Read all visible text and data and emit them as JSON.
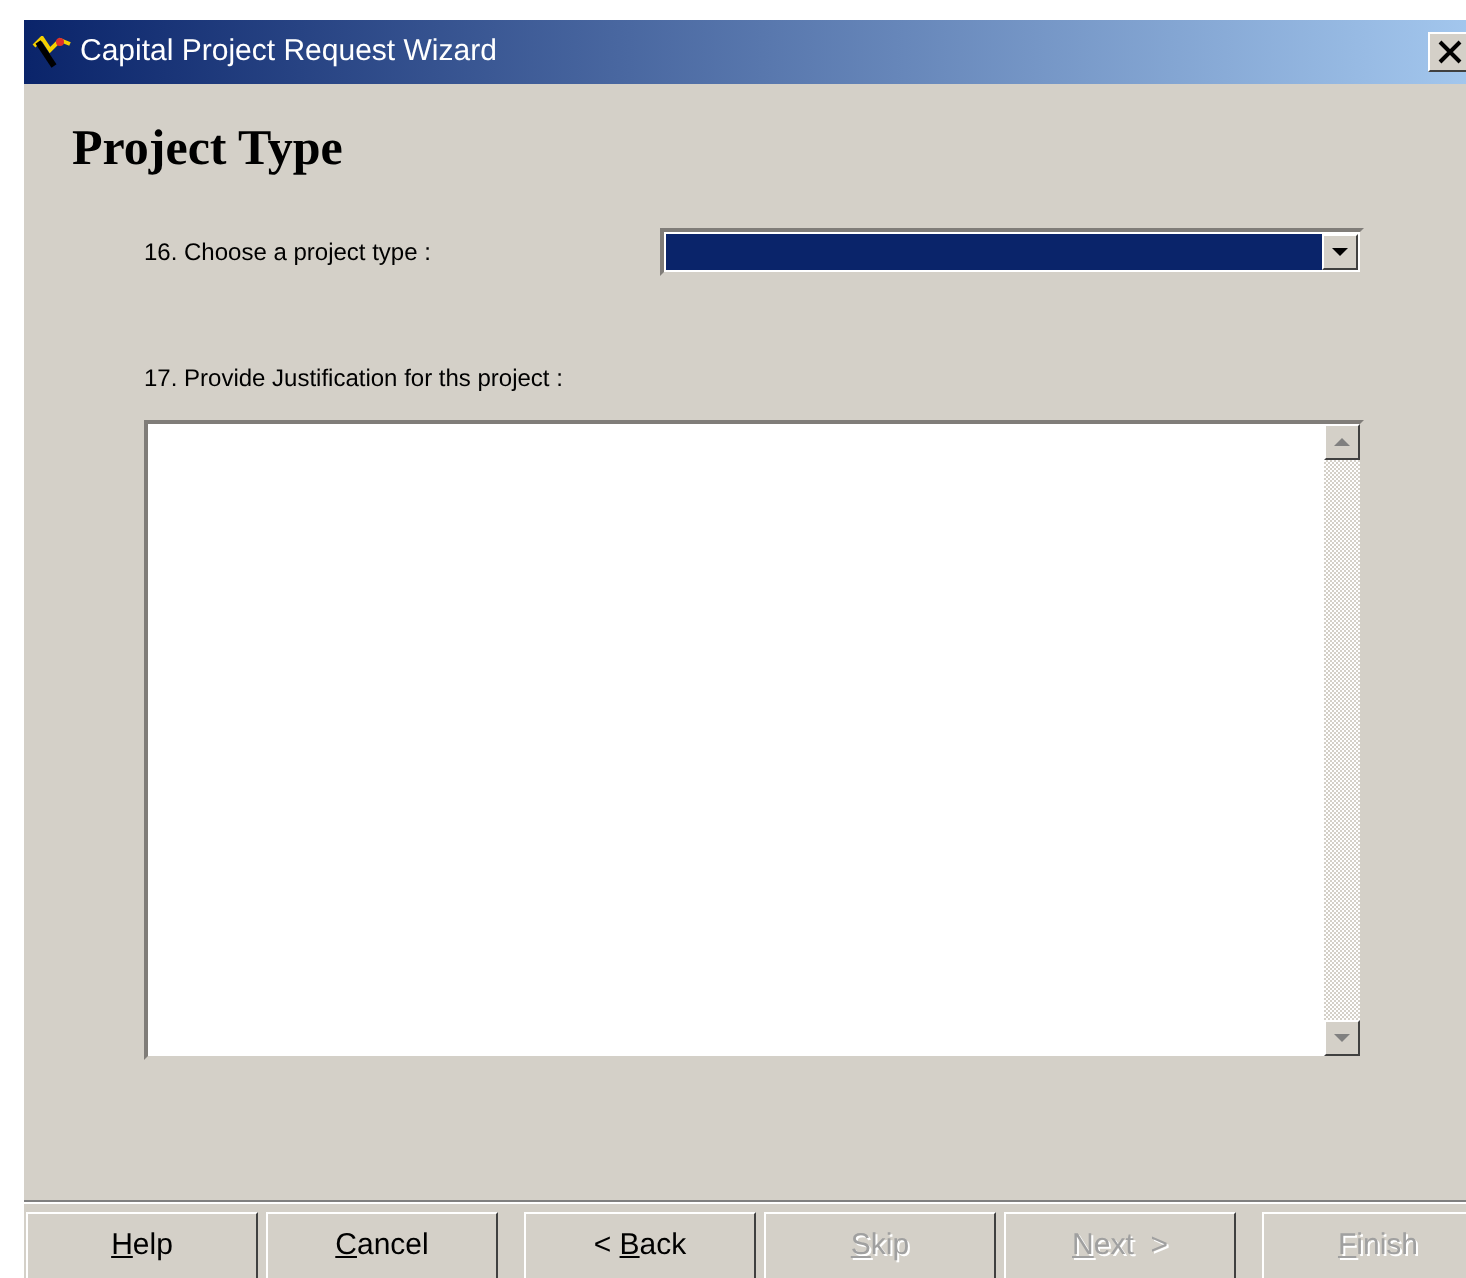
{
  "window": {
    "title": "Capital Project Request Wizard"
  },
  "heading": "Project Type",
  "fields": [
    {
      "kind": "combo",
      "label": "16. Choose a project type :",
      "selected_empty": true
    },
    {
      "kind": "textarea",
      "label": "17. Provide Justification for ths project :"
    }
  ],
  "buttons": [
    {
      "key": "H",
      "post": "elp",
      "disabled": false,
      "group_start": false
    },
    {
      "key": "C",
      "post": "ancel",
      "disabled": false,
      "group_start": false
    },
    {
      "pre": "< ",
      "key": "B",
      "post": "ack",
      "disabled": false,
      "group_start": true
    },
    {
      "key": "S",
      "post": "kip",
      "disabled": true,
      "group_start": false
    },
    {
      "key": "N",
      "post": "ext  >",
      "disabled": true,
      "group_start": false
    },
    {
      "key": "F",
      "post": "inish",
      "disabled": true,
      "group_start": true
    }
  ]
}
